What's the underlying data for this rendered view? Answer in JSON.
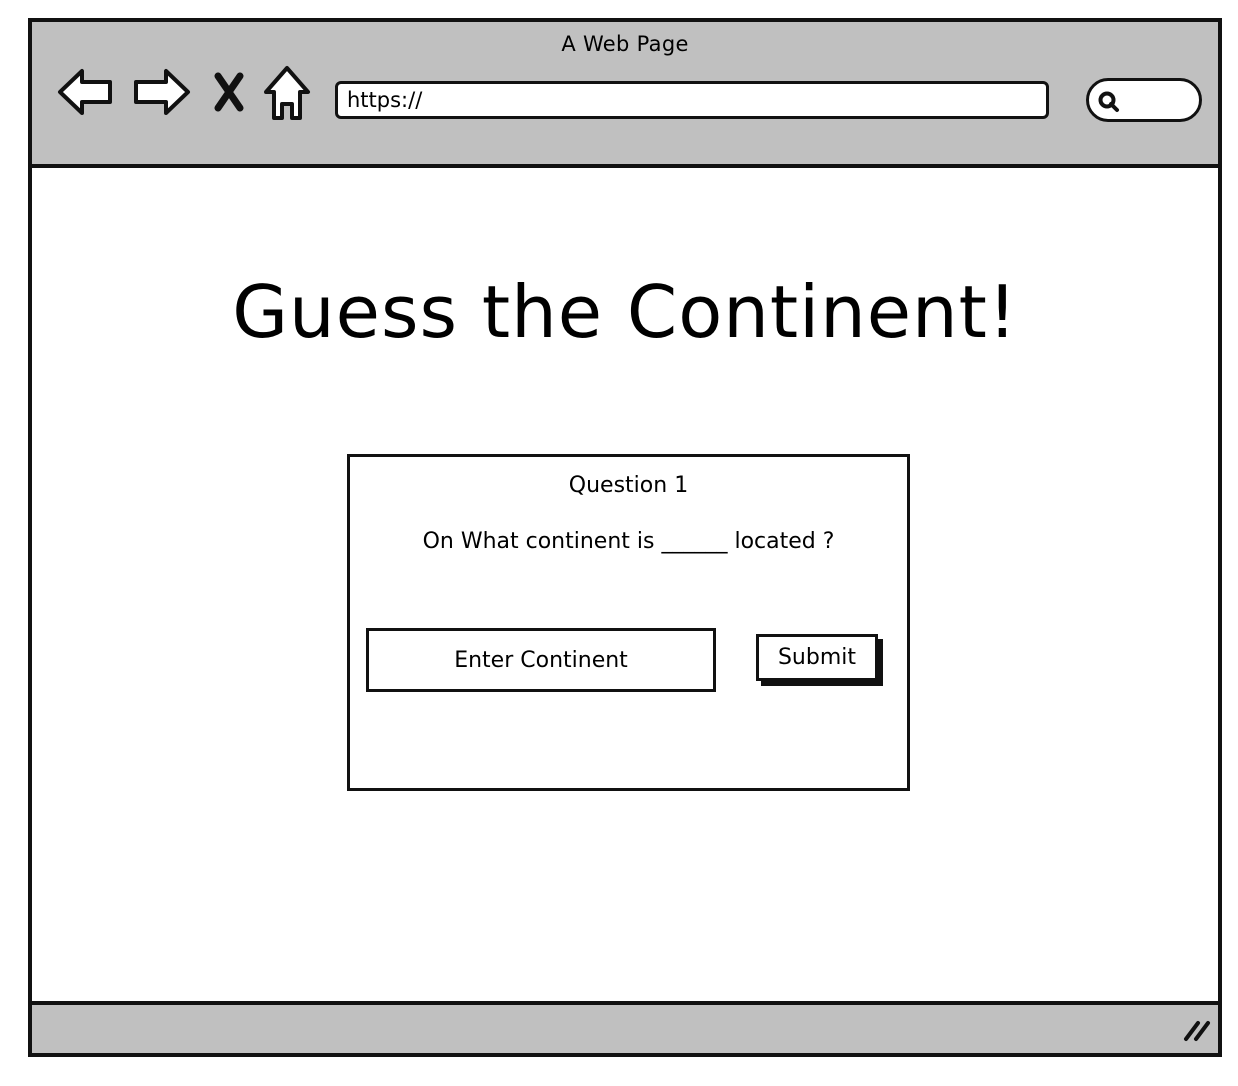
{
  "window": {
    "title": "A Web Page",
    "nav_icons": [
      "back-arrow-icon",
      "forward-arrow-icon",
      "close-icon",
      "home-icon"
    ],
    "url": "https://",
    "search_icon": "search-icon"
  },
  "page": {
    "heading": "Guess the Continent!"
  },
  "quiz": {
    "question_label": "Question 1",
    "question_text": "On What continent is ______ located ?",
    "answer_placeholder": "Enter Continent",
    "submit_label": "Submit"
  },
  "colors": {
    "chrome_bg": "#c0c0c0",
    "stroke": "#111111",
    "page_bg": "#ffffff"
  }
}
